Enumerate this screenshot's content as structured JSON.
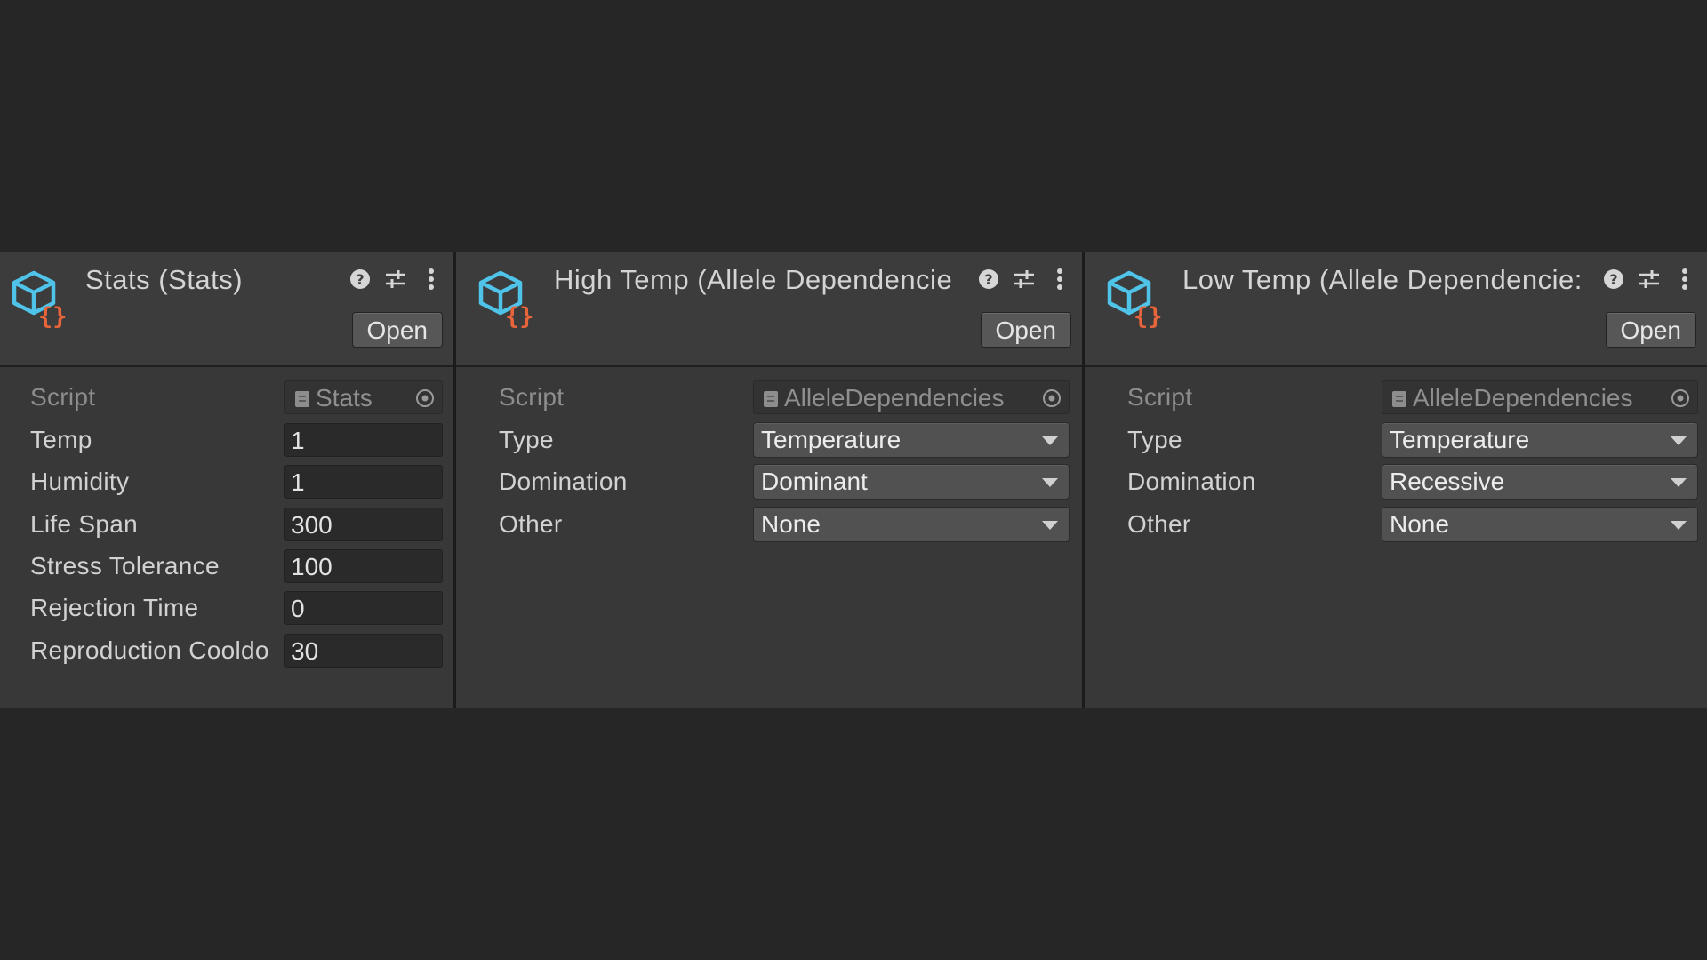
{
  "panels": [
    {
      "title": "Stats (Stats)",
      "open_label": "Open",
      "script": {
        "label": "Script",
        "value": "Stats"
      },
      "fields": [
        {
          "label": "Temp",
          "value": "1"
        },
        {
          "label": "Humidity",
          "value": "1"
        },
        {
          "label": "Life Span",
          "value": "300"
        },
        {
          "label": "Stress Tolerance",
          "value": "100"
        },
        {
          "label": "Rejection Time",
          "value": "0"
        },
        {
          "label": "Reproduction Cooldo",
          "value": "30"
        }
      ]
    },
    {
      "title": "High Temp (Allele Dependencie",
      "open_label": "Open",
      "script": {
        "label": "Script",
        "value": "AlleleDependencies"
      },
      "dropdowns": [
        {
          "label": "Type",
          "value": "Temperature"
        },
        {
          "label": "Domination",
          "value": "Dominant"
        },
        {
          "label": "Other",
          "value": "None"
        }
      ]
    },
    {
      "title": "Low Temp (Allele Dependencie:",
      "open_label": "Open",
      "script": {
        "label": "Script",
        "value": "AlleleDependencies"
      },
      "dropdowns": [
        {
          "label": "Type",
          "value": "Temperature"
        },
        {
          "label": "Domination",
          "value": "Recessive"
        },
        {
          "label": "Other",
          "value": "None"
        }
      ]
    }
  ],
  "icons": {
    "asset": "scriptable-object-icon",
    "help": "help-icon",
    "presets": "presets-icon",
    "menu": "kebab-menu-icon",
    "script": "script-file-icon",
    "picker": "object-picker-icon"
  },
  "colors": {
    "cube": "#4fc3e8",
    "braces": "#e8643a",
    "background": "#262626",
    "panel": "#383838"
  }
}
